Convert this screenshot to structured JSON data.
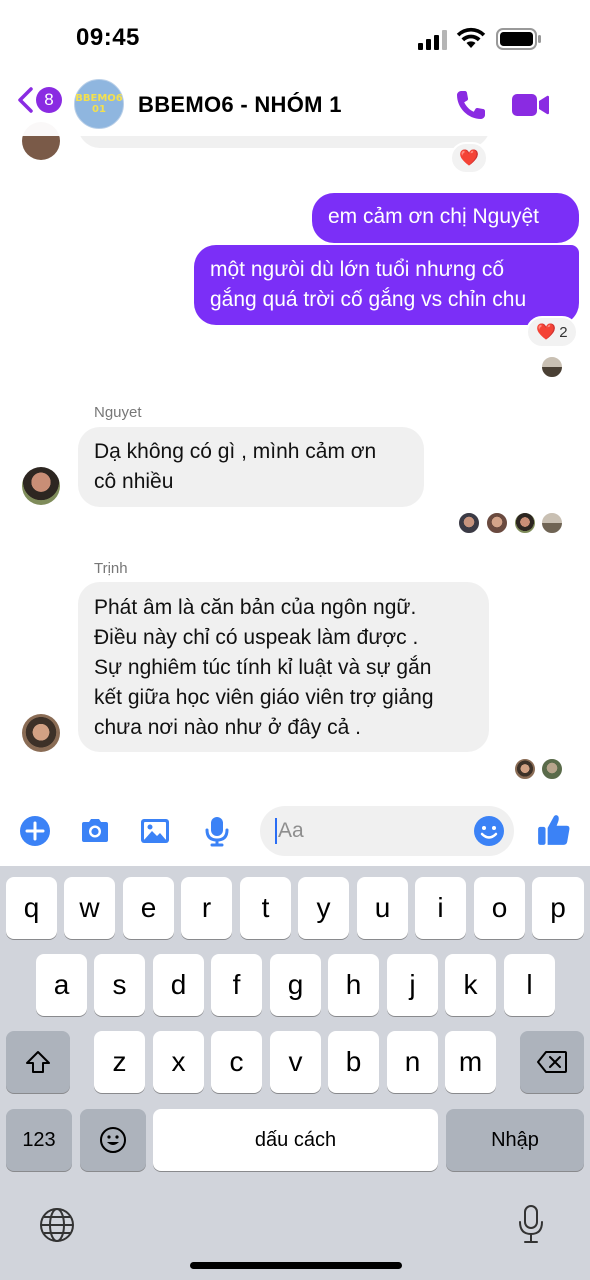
{
  "status_bar": {
    "time": "09:45"
  },
  "header": {
    "back_badge": "8",
    "avatar_text_line1": "BBEMO6",
    "avatar_text_line2": "01",
    "title": "BBEMO6 - NHÓM 1",
    "call_icon": "phone-icon",
    "video_icon": "video-camera-icon"
  },
  "messages": {
    "top_partial_reaction": "❤️",
    "out1": "em cảm ơn chị Nguyệt",
    "out2_line1": "một ngưòi  dù lớn tuổi nhưng cố",
    "out2_line2": "gắng quá trời cố gắng vs chỉn chu",
    "out2_reaction": "❤️",
    "out2_reaction_count": "2",
    "nguyet_name": "Nguyet",
    "nguyet_line1": "Dạ không có gì , mình cảm ơn",
    "nguyet_line2": "cô nhiều",
    "trinh_name": "Trịnh",
    "trinh_line1": "Phát âm  là căn bản của ngôn ngữ.",
    "trinh_line2": "Điều này chỉ có uspeak làm được .",
    "trinh_line3": "Sự nghiêm túc tính kỉ luật và sự gắn",
    "trinh_line4": "kết giữa học viên giáo viên trợ giảng",
    "trinh_line5": "chưa nơi nào như ở đây cả ."
  },
  "composer": {
    "placeholder": "Aa",
    "icons": [
      "plus-icon",
      "camera-icon",
      "image-icon",
      "microphone-icon",
      "emoji-icon",
      "thumbs-up-icon"
    ]
  },
  "keyboard": {
    "row1": [
      "q",
      "w",
      "e",
      "r",
      "t",
      "y",
      "u",
      "i",
      "o",
      "p"
    ],
    "row2": [
      "a",
      "s",
      "d",
      "f",
      "g",
      "h",
      "j",
      "k",
      "l"
    ],
    "row3": [
      "z",
      "x",
      "c",
      "v",
      "b",
      "n",
      "m"
    ],
    "numbers_key": "123",
    "space_key": "dấu cách",
    "return_key": "Nhập"
  },
  "colors": {
    "accent": "#7b2ff7",
    "badge": "#8a2be2",
    "composer_icon": "#3b82f6"
  }
}
